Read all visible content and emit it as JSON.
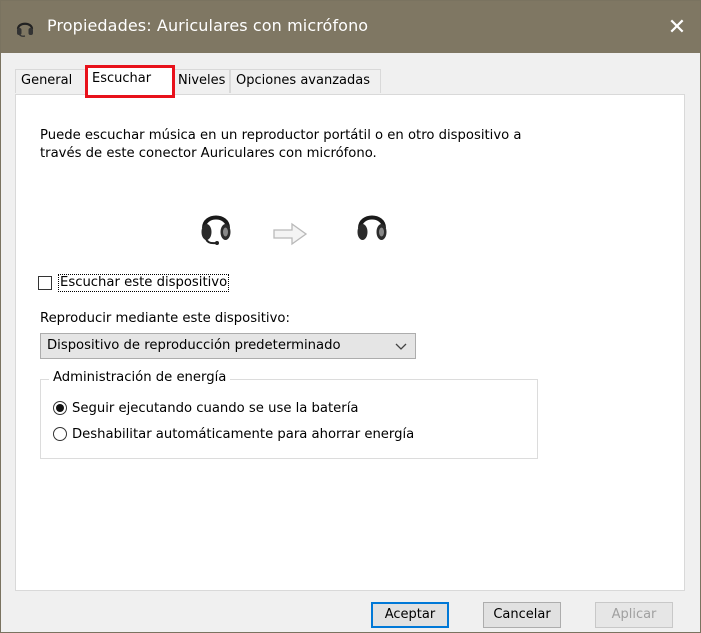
{
  "window": {
    "title": "Propiedades: Auriculares con micrófono",
    "close_symbol": "✕",
    "titlebar_color": "#7f7763"
  },
  "tabs": [
    {
      "label": "General",
      "active": false
    },
    {
      "label": "Escuchar",
      "active": true
    },
    {
      "label": "Niveles",
      "active": false
    },
    {
      "label": "Opciones avanzadas",
      "active": false
    }
  ],
  "highlight_color": "#e8111b",
  "listen": {
    "description": "Puede escuchar música en un reproductor portátil o en otro dispositivo a través de este conector Auriculares con micrófono.",
    "icons": [
      "headset-source-icon",
      "arrow-right-icon",
      "headset-target-icon"
    ],
    "checkbox_label": "Escuchar este dispositivo",
    "checkbox_checked": false,
    "playback_label": "Reproducir mediante este dispositivo:",
    "playback_selected": "Dispositivo de reproducción predeterminado"
  },
  "power": {
    "legend": "Administración de energía",
    "options": [
      {
        "label": "Seguir ejecutando cuando se use la batería",
        "checked": true
      },
      {
        "label": "Deshabilitar automáticamente para ahorrar energía",
        "checked": false
      }
    ]
  },
  "buttons": {
    "ok": "Aceptar",
    "cancel": "Cancelar",
    "apply": "Aplicar",
    "apply_enabled": false,
    "accent": "#0078d7"
  }
}
